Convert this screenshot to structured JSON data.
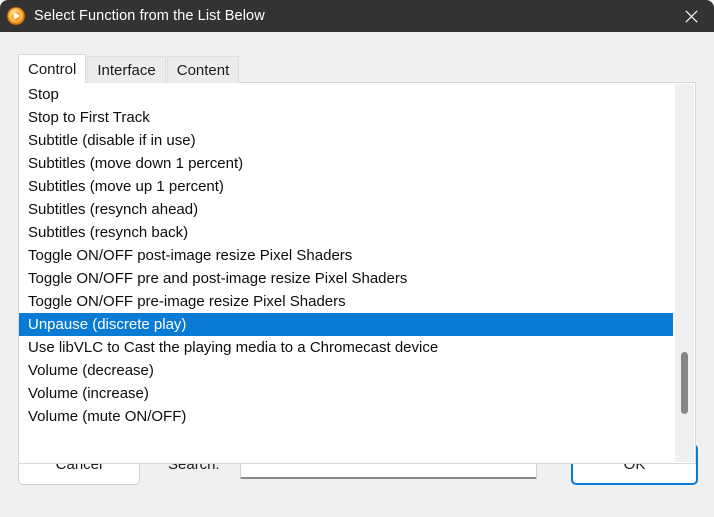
{
  "window": {
    "title": "Select Function from the List Below",
    "icon": "media-player-play-icon",
    "close_label": "×",
    "titlebar_color": "#333333",
    "body_color": "#f0f0f0"
  },
  "tabs": [
    {
      "label": "Control",
      "selected": true
    },
    {
      "label": "Interface",
      "selected": false
    },
    {
      "label": "Content",
      "selected": false
    }
  ],
  "list": {
    "selected_index": 10,
    "selection_color": "#0a7bd4",
    "items": [
      "Stop",
      "Stop to First Track",
      "Subtitle (disable if in use)",
      "Subtitles (move down 1 percent)",
      "Subtitles (move up 1 percent)",
      "Subtitles (resynch ahead)",
      "Subtitles (resynch back)",
      "Toggle ON/OFF post-image resize Pixel Shaders",
      "Toggle ON/OFF pre and post-image resize Pixel Shaders",
      "Toggle ON/OFF pre-image resize Pixel Shaders",
      "Unpause (discrete play)",
      "Use libVLC to Cast the playing media to a Chromecast device",
      "Volume (decrease)",
      "Volume (increase)",
      "Volume (mute ON/OFF)"
    ]
  },
  "footer": {
    "cancel_label": "Cancel",
    "search_label": "Search:",
    "search_value": "",
    "search_placeholder": "",
    "ok_label": "OK",
    "ok_focus_color": "#0a7bd4"
  }
}
